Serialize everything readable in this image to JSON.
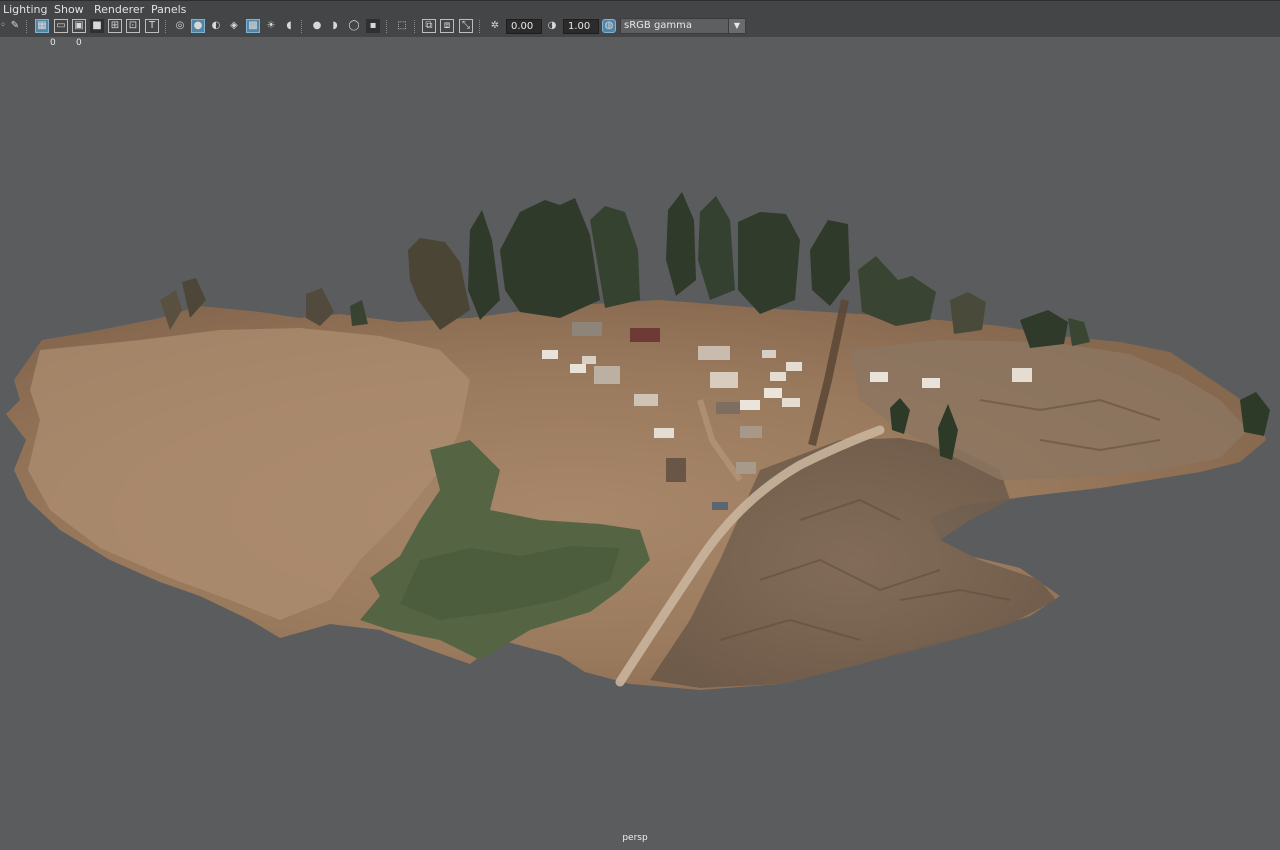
{
  "menubar": {
    "items": [
      {
        "label": "Lighting"
      },
      {
        "label": "Show"
      },
      {
        "label": "Renderer"
      },
      {
        "label": "Panels"
      }
    ]
  },
  "toolbar": {
    "exposure_value": "0.00",
    "gamma_value": "1.00",
    "color_space": "sRGB gamma",
    "icons": [
      "camera-icon",
      "pencil-icon",
      "grid-icon",
      "film-gate-icon",
      "resolution-gate-icon",
      "gate-mask-icon",
      "field-chart-icon",
      "safe-action-icon",
      "safe-title-icon",
      "wireframe-icon",
      "smooth-shade-icon",
      "default-material-icon",
      "wireframe-on-shaded-icon",
      "textured-icon",
      "use-all-lights-icon",
      "shadows-icon",
      "screen-space-ao-icon",
      "motion-blur-icon",
      "anti-aliasing-icon",
      "depth-of-field-icon",
      "isolate-select-icon",
      "xray-icon",
      "xray-active-components-icon",
      "xray-joints-icon",
      "exposure-icon",
      "gamma-icon",
      "color-management-icon"
    ]
  },
  "hud": {
    "counter_a": "0",
    "counter_b": "0"
  },
  "viewport": {
    "camera_label": "persp"
  }
}
